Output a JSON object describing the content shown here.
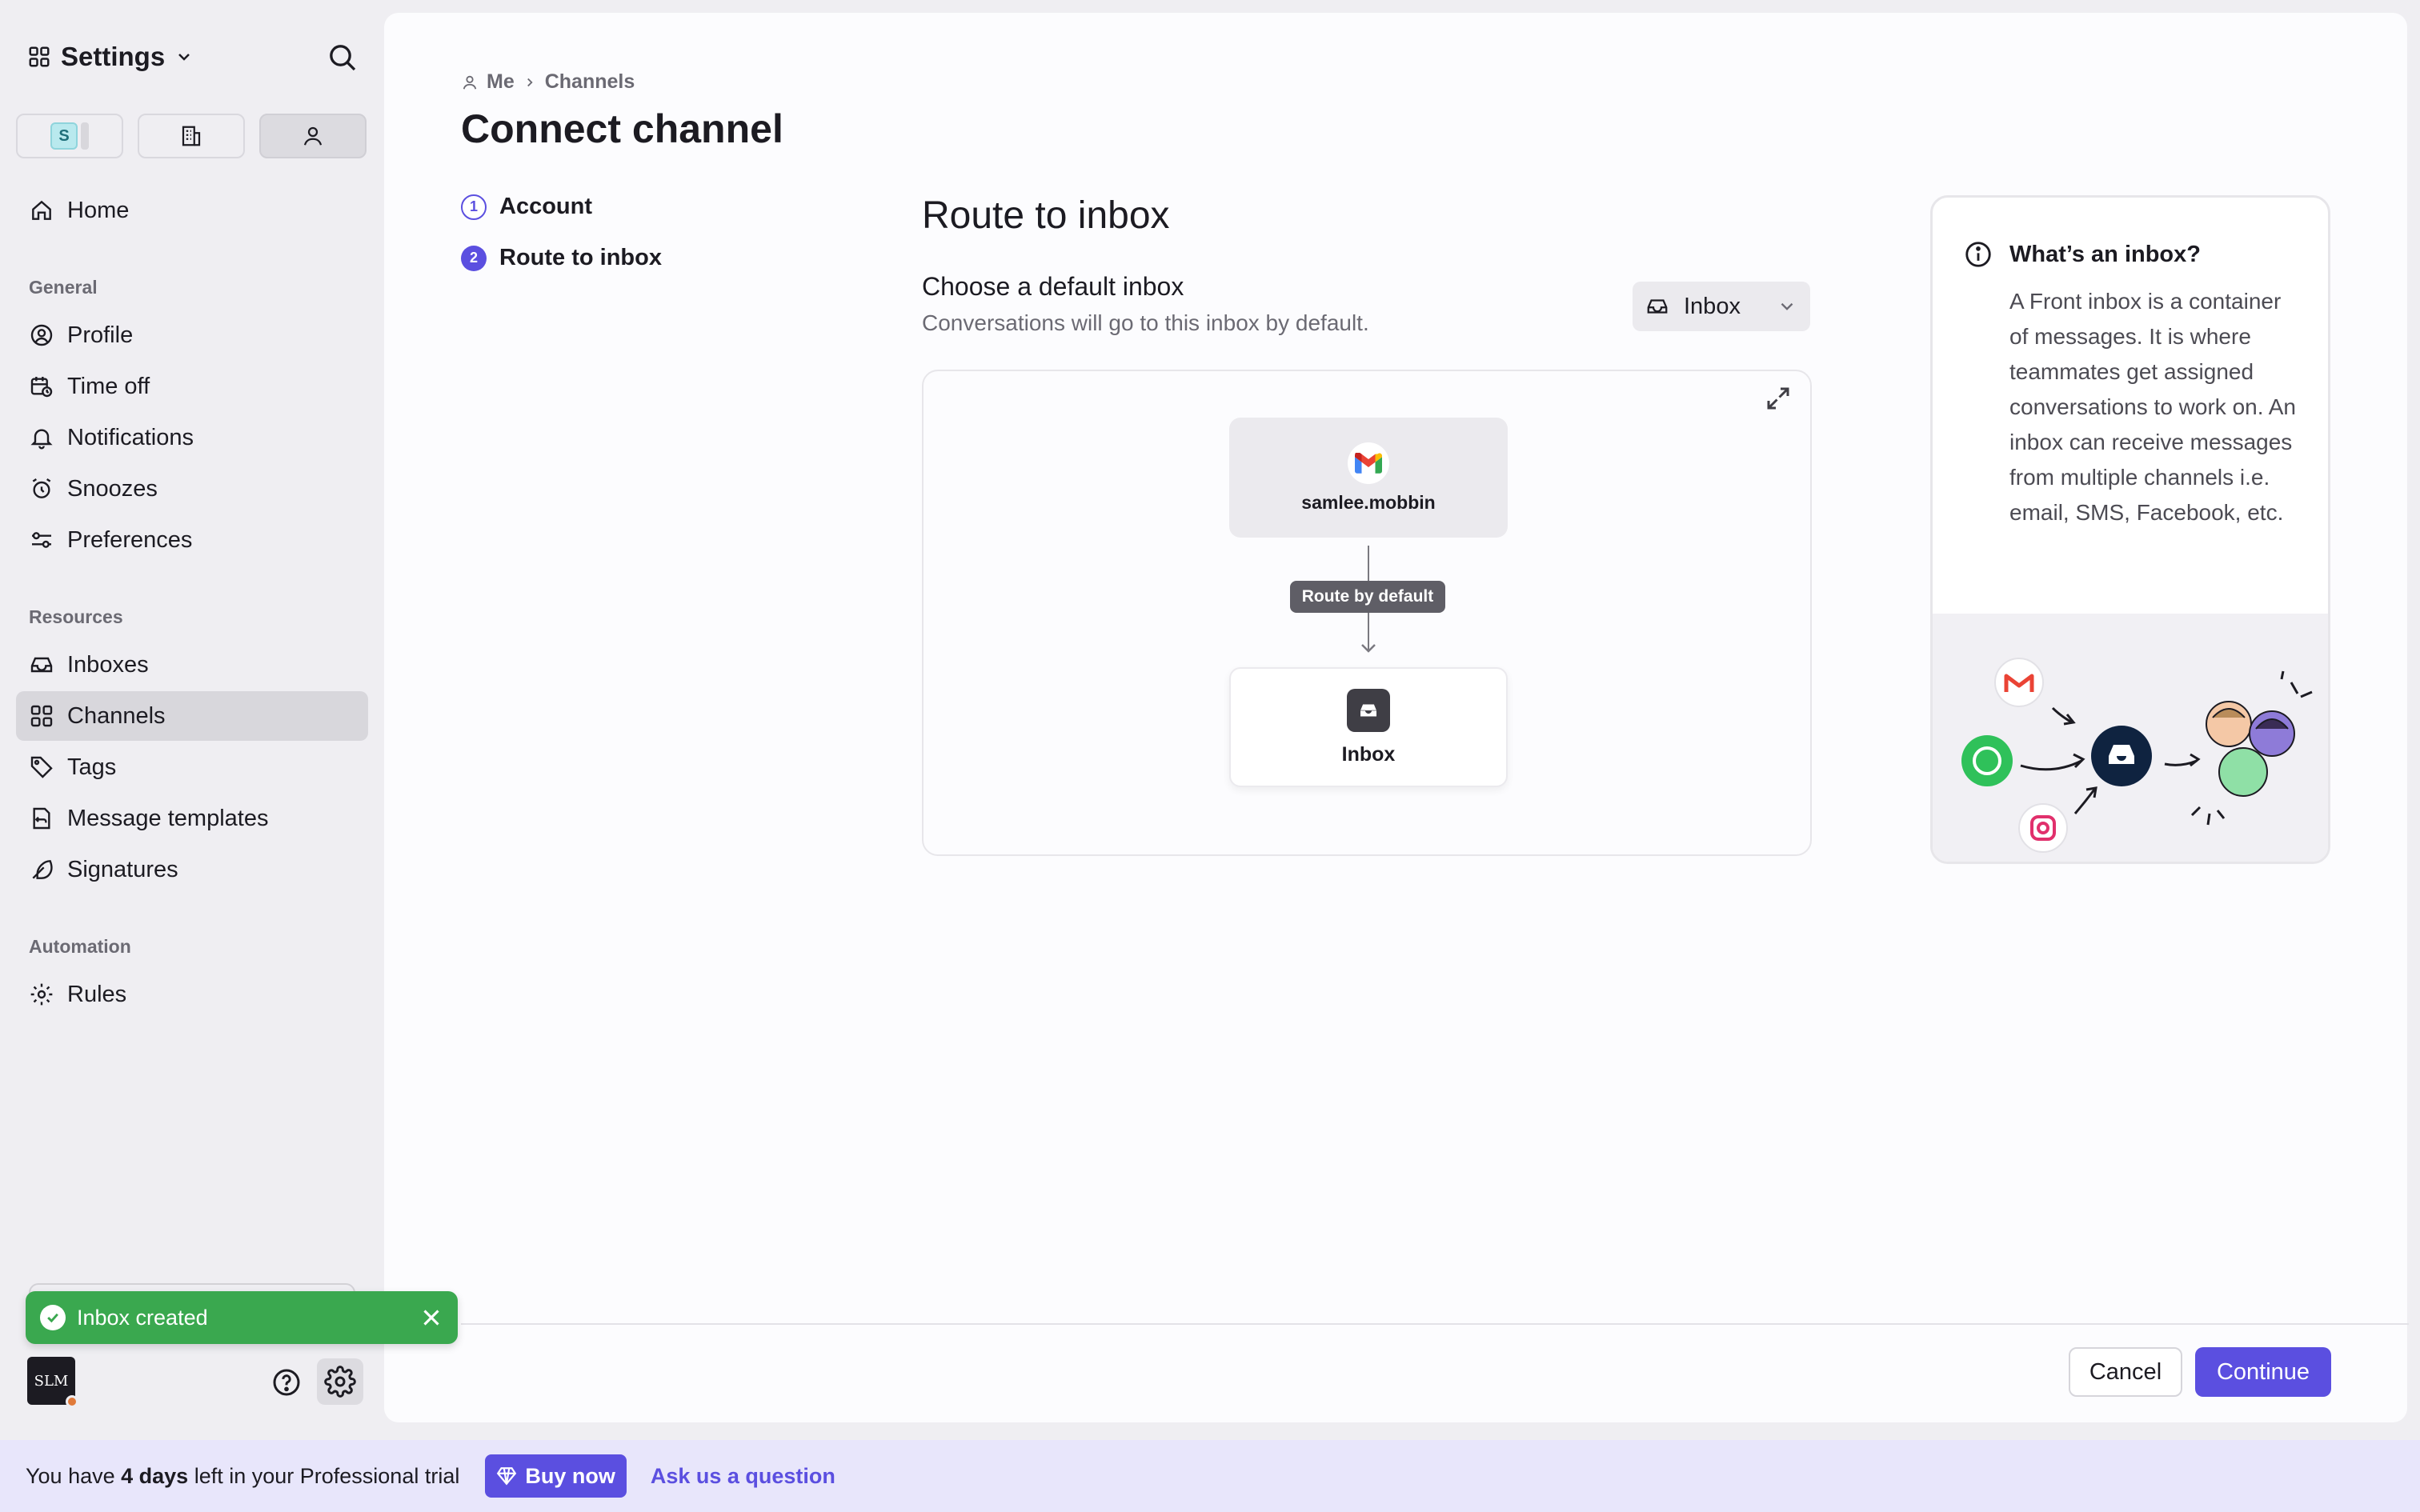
{
  "sidebar": {
    "title": "Settings",
    "tabs": [
      {
        "label": "S",
        "name": "personal-workspace-tab"
      },
      {
        "label": "",
        "name": "company-tab"
      },
      {
        "label": "",
        "name": "me-tab"
      }
    ],
    "home": "Home",
    "sections": [
      {
        "label": "General",
        "items": [
          "Profile",
          "Time off",
          "Notifications",
          "Snoozes",
          "Preferences"
        ]
      },
      {
        "label": "Resources",
        "items": [
          "Inboxes",
          "Channels",
          "Tags",
          "Message templates",
          "Signatures"
        ]
      },
      {
        "label": "Automation",
        "items": [
          "Rules"
        ]
      }
    ],
    "active_item": "Channels",
    "user_initials": "SLM"
  },
  "toast": {
    "text": "Inbox created",
    "color": "#3aa84f"
  },
  "main": {
    "breadcrumb": [
      "Me",
      "Channels"
    ],
    "title": "Connect channel",
    "steps": [
      {
        "num": "1",
        "label": "Account"
      },
      {
        "num": "2",
        "label": "Route to inbox"
      }
    ],
    "section_title": "Route to inbox",
    "choose_label": "Choose a default inbox",
    "choose_sub": "Conversations will go to this inbox by default.",
    "inbox_select_value": "Inbox",
    "diagram": {
      "source_label": "samlee.mobbin",
      "route_badge": "Route by default",
      "target_label": "Inbox"
    },
    "info": {
      "title": "What’s an inbox?",
      "body": "A Front inbox is a container of messages. It is where teammates get assigned conversations to work on. An inbox can receive messages from multiple channels i.e. email, SMS, Facebook, etc."
    },
    "footer": {
      "cancel": "Cancel",
      "continue": "Continue"
    }
  },
  "trial": {
    "prefix": "You have ",
    "days": "4 days",
    "suffix": " left in your Professional trial",
    "buy": "Buy now",
    "ask": "Ask us a question"
  },
  "colors": {
    "accent": "#5b4fe0",
    "success": "#3aa84f"
  }
}
